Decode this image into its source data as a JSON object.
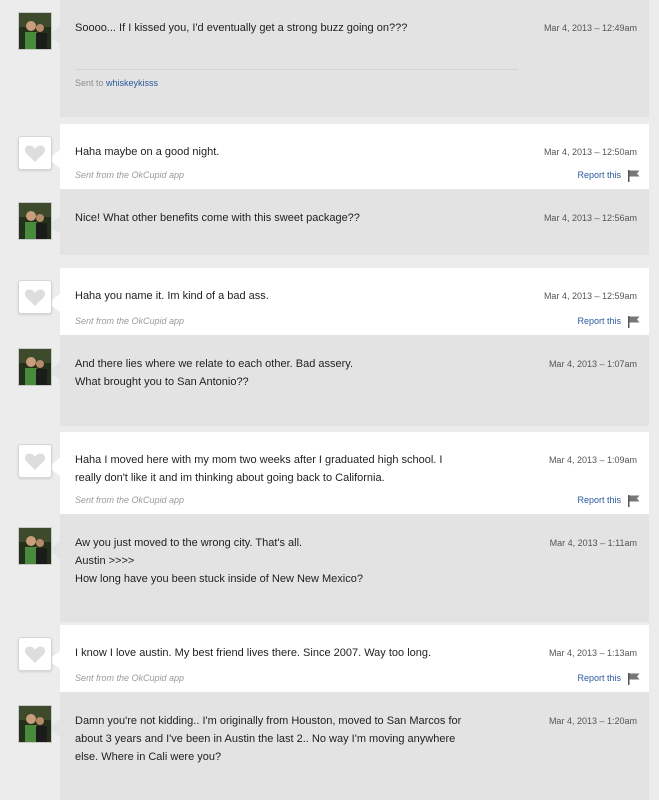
{
  "sent_to": {
    "label": "Sent to",
    "username": "whiskeykisss"
  },
  "app_note": "Sent from the OkCupid app",
  "report_label": "Report this",
  "icons": {
    "avatar": "user-photo-avatar",
    "heart": "heart-icon",
    "flag": "flag-icon"
  },
  "colors": {
    "sent_bubble": "#e3e3e3",
    "received_bubble": "#ffffff",
    "link": "#2a5a9d",
    "page_background": "#ececec"
  },
  "messages": [
    {
      "direction": "sent",
      "lines": [
        "Soooo... If I kissed you, I'd eventually get a strong buzz going on???"
      ],
      "time": "Mar 4, 2013 – 12:49am"
    },
    {
      "direction": "received",
      "lines": [
        "Haha maybe on a good night."
      ],
      "time": "Mar 4, 2013 – 12:50am"
    },
    {
      "direction": "sent",
      "lines": [
        "Nice! What other benefits come with this sweet package??"
      ],
      "time": "Mar 4, 2013 – 12:56am"
    },
    {
      "direction": "received",
      "lines": [
        "Haha you name it. Im kind of a bad ass."
      ],
      "time": "Mar 4, 2013 – 12:59am"
    },
    {
      "direction": "sent",
      "lines": [
        "And there lies where we relate to each other. Bad assery.",
        "What brought you to San Antonio??"
      ],
      "time": "Mar 4, 2013 – 1:07am"
    },
    {
      "direction": "received",
      "lines": [
        "Haha I moved here with my mom two weeks after I graduated high school. I",
        "really don't like it and im thinking about going back to California."
      ],
      "time": "Mar 4, 2013 – 1:09am"
    },
    {
      "direction": "sent",
      "lines": [
        "Aw you just moved to the wrong city. That's all.",
        "Austin >>>>",
        "How long have you been stuck inside of New New Mexico?"
      ],
      "time": "Mar 4, 2013 – 1:11am"
    },
    {
      "direction": "received",
      "lines": [
        "I know I love austin. My best friend lives there. Since 2007. Way too long."
      ],
      "time": "Mar 4, 2013 – 1:13am"
    },
    {
      "direction": "sent",
      "lines": [
        "Damn you're not kidding.. I'm originally from Houston, moved to San Marcos for",
        "about 3 years and I've been in Austin the last 2.. No way I'm moving anywhere",
        "else. Where in Cali were you?"
      ],
      "time": "Mar 4, 2013 – 1:20am"
    }
  ]
}
